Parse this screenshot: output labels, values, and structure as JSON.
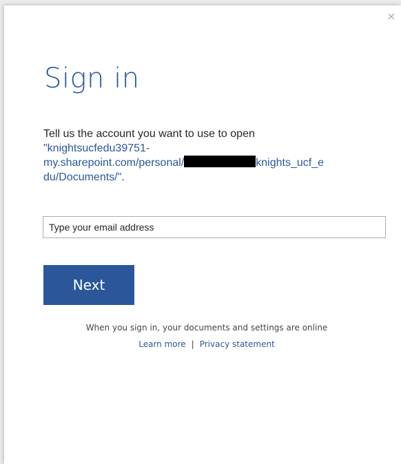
{
  "dialog": {
    "title": "Sign in",
    "message_prefix": "Tell us the account you want to use to open",
    "url_part1": "\"knightsucfedu39751-",
    "url_part2": "my.sharepoint.com/personal/",
    "url_part3": "knights_ucf_e",
    "url_part4": "du/Documents/\"",
    "url_end": ".",
    "email_placeholder": "Type your email address",
    "next_label": "Next",
    "info_text": "When you sign in, your documents and settings are online",
    "learn_more": "Learn more",
    "separator": "|",
    "privacy": "Privacy statement"
  },
  "icons": {
    "close": "close-icon"
  },
  "colors": {
    "accent": "#2b579a",
    "text": "#262626",
    "redaction": "#000000"
  }
}
